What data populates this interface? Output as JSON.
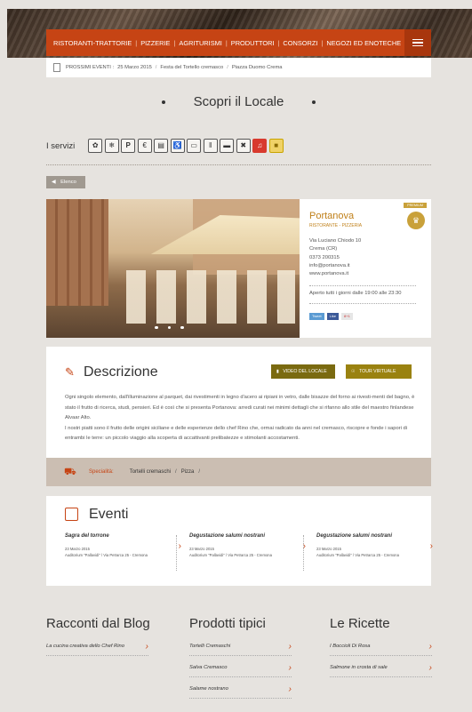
{
  "nav": {
    "items": [
      "RISTORANTI-TRATTORIE",
      "PIZZERIE",
      "AGRITURISMI",
      "PRODUTTORI",
      "CONSORZI",
      "NEGOZI ED ENOTECHE"
    ]
  },
  "breadcrumb": {
    "label": "PROSSIMI EVENTI :",
    "date": "25 Marzo 2015",
    "event": "Festa del Tortello cremasco",
    "place": "Piazza Duomo Crema"
  },
  "section_title": "Scopri il Locale",
  "services": {
    "label": "I servizi",
    "icons": [
      "leaf-icon",
      "snowflake-icon",
      "parking-icon",
      "euro-icon",
      "card-icon",
      "wheelchair-icon",
      "ticket-icon",
      "cutlery-icon",
      "bowl-icon",
      "no-smoking-icon",
      "guitar-icon",
      "gift-icon"
    ]
  },
  "back_button": "Elenco",
  "venue": {
    "premium": "PREMIUM",
    "name": "Portanova",
    "type": "RISTORANTE - PIZZERIA",
    "address_1": "Via Luciano Chiodo 10",
    "address_2": "Crema (CR)",
    "phone": "0373 200315",
    "email": "info@portanova.it",
    "website": "www.portanova.it",
    "hours": "Aperto tutti i giorni dalle 19:00 alle 23:30",
    "social": [
      "Tweet",
      "Like",
      "8+1"
    ]
  },
  "description": {
    "title": "Descrizione",
    "video_button": "VIDEO DEL LOCALE",
    "tour_button": "TOUR VIRTUALE",
    "paragraph_1": "Ogni singolo elemento, dall'illuminazione al parquet, dai rivestimenti in legno d'acero ai ripiani in vetro, dalle bisazze del forno ai rivesti-menti del bagno, è stato il frutto di ricerca, studi, pensieri. Ed è così che si presenta Portanova: arredi curati nei minimi dettagli che si rifanno allo stile del maestro finlandese Alvaar Alto.",
    "paragraph_2": "I nostri piatti sono il frutto delle origini siciliane e delle esperienze dello chef Rino che, ormai radicato da anni nel cremasco, riscopre e fonde i sapori di entrambi le terre: un piccolo viaggio alla scoperta di accattivanti prelibatezze e stimolanti accostamenti.",
    "special_label": "Specialità:",
    "specials": [
      "Tortelli cremaschi",
      "Pizza"
    ]
  },
  "events": {
    "title": "Eventi",
    "items": [
      {
        "title": "Sagra del torrone",
        "date": "23 Marzo 2015",
        "place": "Auditorium \"Pallavidi\" / Via Petrarca 25 - Cremona"
      },
      {
        "title": "Degustazione salumi nostrani",
        "date": "23 Marzo 2015",
        "place": "Auditorium \"Pallavidi\" / Via Petrarca 25 - Cremona"
      },
      {
        "title": "Degustazione salumi nostrani",
        "date": "23 Marzo 2015",
        "place": "Auditorium \"Pallavidi\" / Via Petrarca 25 - Cremona"
      }
    ]
  },
  "columns": [
    {
      "title": "Racconti dal Blog",
      "items": [
        "La cucina creativa dello Chef Rino"
      ]
    },
    {
      "title": "Prodotti tipici",
      "items": [
        "Tortelli Cremaschi",
        "Salva Cremasco",
        "Salame nostrano"
      ]
    },
    {
      "title": "Le Ricette",
      "items": [
        "I Boccioli Di Rosa",
        "Salmone in crosta di sale"
      ]
    }
  ]
}
